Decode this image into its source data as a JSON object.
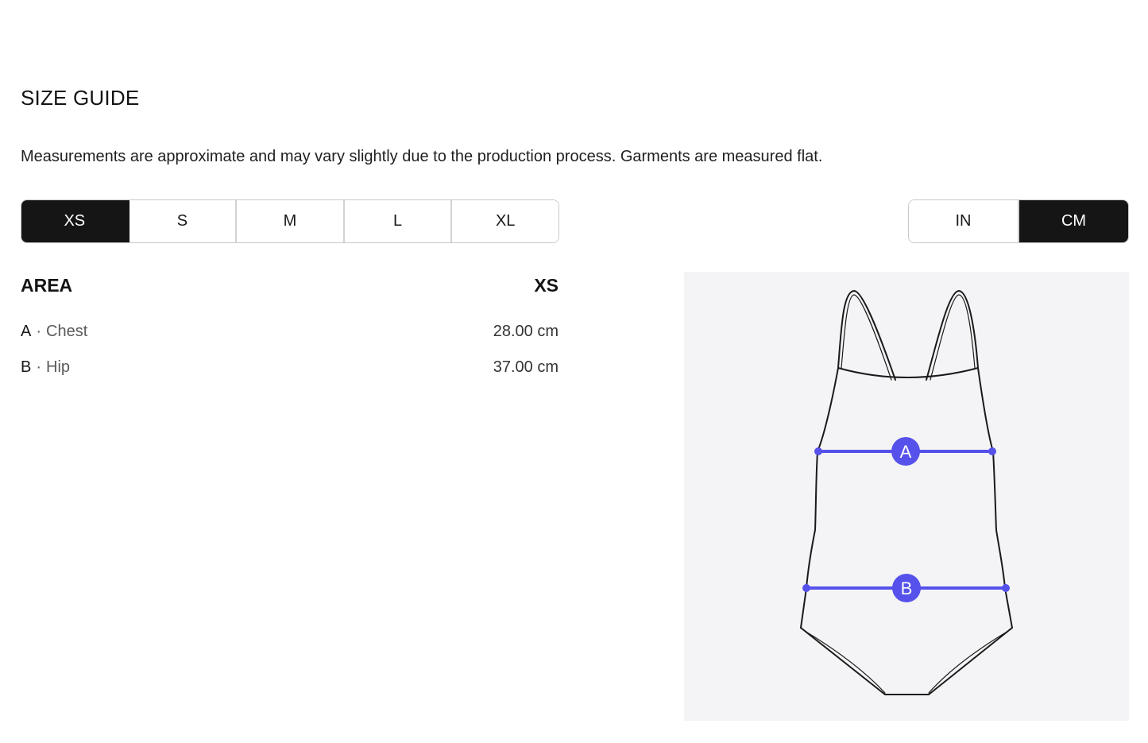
{
  "header": {
    "title": "SIZE GUIDE",
    "subtitle": "Measurements are approximate and may vary slightly due to the production process. Garments are measured flat."
  },
  "size_selector": {
    "options": [
      "XS",
      "S",
      "M",
      "L",
      "XL"
    ],
    "selected": "XS"
  },
  "unit_selector": {
    "options": [
      "IN",
      "CM"
    ],
    "selected": "CM"
  },
  "table": {
    "col_area": "AREA",
    "col_size": "XS",
    "rows": [
      {
        "letter": "A",
        "sep": "·",
        "area": "Chest",
        "value": "28.00 cm"
      },
      {
        "letter": "B",
        "sep": "·",
        "area": "Hip",
        "value": "37.00 cm"
      }
    ]
  },
  "diagram": {
    "markers": [
      {
        "label": "A"
      },
      {
        "label": "B"
      }
    ]
  },
  "colors": {
    "accent": "#5551ea",
    "selected_bg": "#151515",
    "diagram_bg": "#f4f4f6"
  }
}
